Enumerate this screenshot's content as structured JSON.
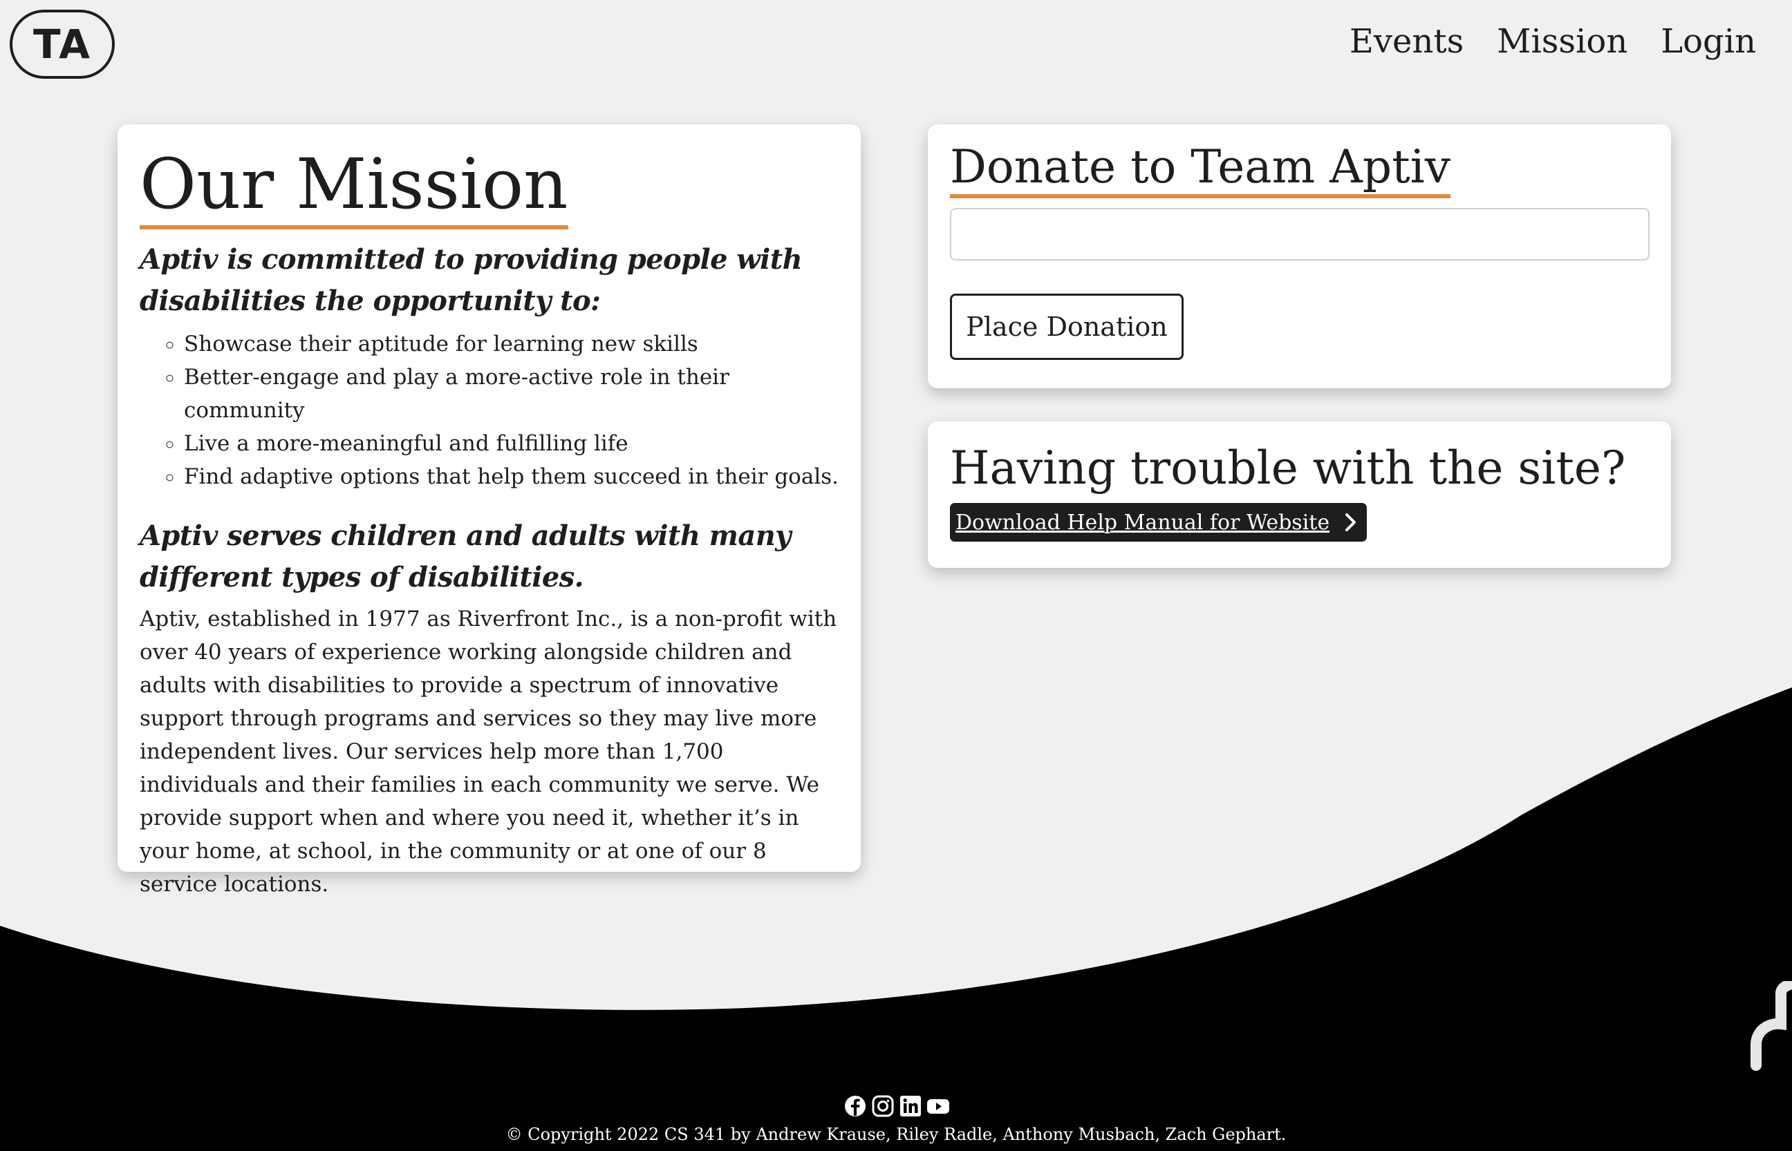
{
  "header": {
    "logo_text": "TA",
    "nav": [
      {
        "label": "Events"
      },
      {
        "label": "Mission"
      },
      {
        "label": "Login"
      }
    ]
  },
  "mission": {
    "title": "Our Mission",
    "lead1": "Aptiv is committed to providing people with disabilities the opportunity to:",
    "goals": [
      "Showcase their aptitude for learning new skills",
      "Better-engage and play a more-active role in their community",
      "Live a more-meaningful and fulfilling life",
      "Find adaptive options that help them succeed in their goals."
    ],
    "lead2": "Aptiv serves children and adults with many different types of disabilities.",
    "body": "Aptiv, established in 1977 as Riverfront Inc., is a non-profit with over 40 years of experience working alongside children and adults with disabilities to provide a spectrum of innovative support through programs and services so they may live more independent lives. Our services help more than 1,700 individuals and their families in each community we serve. We provide support when and where you need it, whether it’s in your home, at school, in the community or at one of our 8 service locations."
  },
  "donate": {
    "title": "Donate to Team Aptiv",
    "input_value": "",
    "input_placeholder": "",
    "button_label": "Place Donation"
  },
  "help": {
    "title": "Having trouble with the site?",
    "button_label": "Download Help Manual for Website"
  },
  "footer": {
    "social_icons": [
      "facebook-icon",
      "instagram-icon",
      "linkedin-icon",
      "youtube-icon"
    ],
    "copyright": "© Copyright 2022 CS 341 by Andrew Krause, Riley Radle, Anthony Musbach, Zach Gephart."
  },
  "colors": {
    "background": "#f0f0f0",
    "accent_underline": "#e08a3c",
    "footer": "#000000",
    "text": "#1e1e1e"
  }
}
